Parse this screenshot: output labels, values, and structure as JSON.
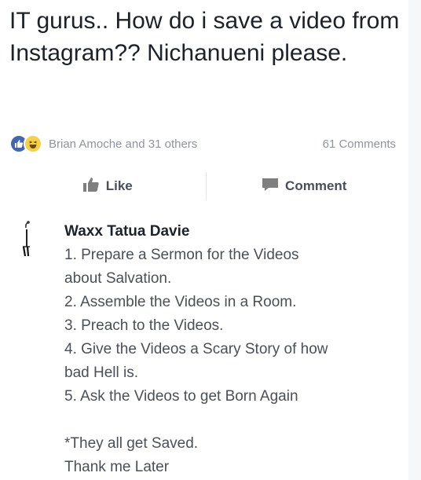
{
  "post": {
    "text": "IT gurus.. How do i save a video from Instagram?? Nichanueni please."
  },
  "reactions": {
    "reactors": "Brian Amoche and 31 others",
    "comments": "61 Comments",
    "icons": [
      "like-icon",
      "haha-icon"
    ],
    "like_color": "#4267b2",
    "haha_color": "#f7d04a"
  },
  "actions": {
    "like_label": "Like",
    "comment_label": "Comment"
  },
  "comment": {
    "author": "Waxx Tatua Davie",
    "lines": [
      "1. Prepare a Sermon for the Videos",
      "about Salvation.",
      "2. Assemble the Videos in a Room.",
      "3. Preach to the Videos.",
      "4. Give the Videos a Scary Story of how",
      "bad Hell is.",
      "5. Ask the Videos to get Born Again"
    ],
    "footer_lines": [
      "*They all get Saved.",
      "Thank me Later"
    ]
  }
}
